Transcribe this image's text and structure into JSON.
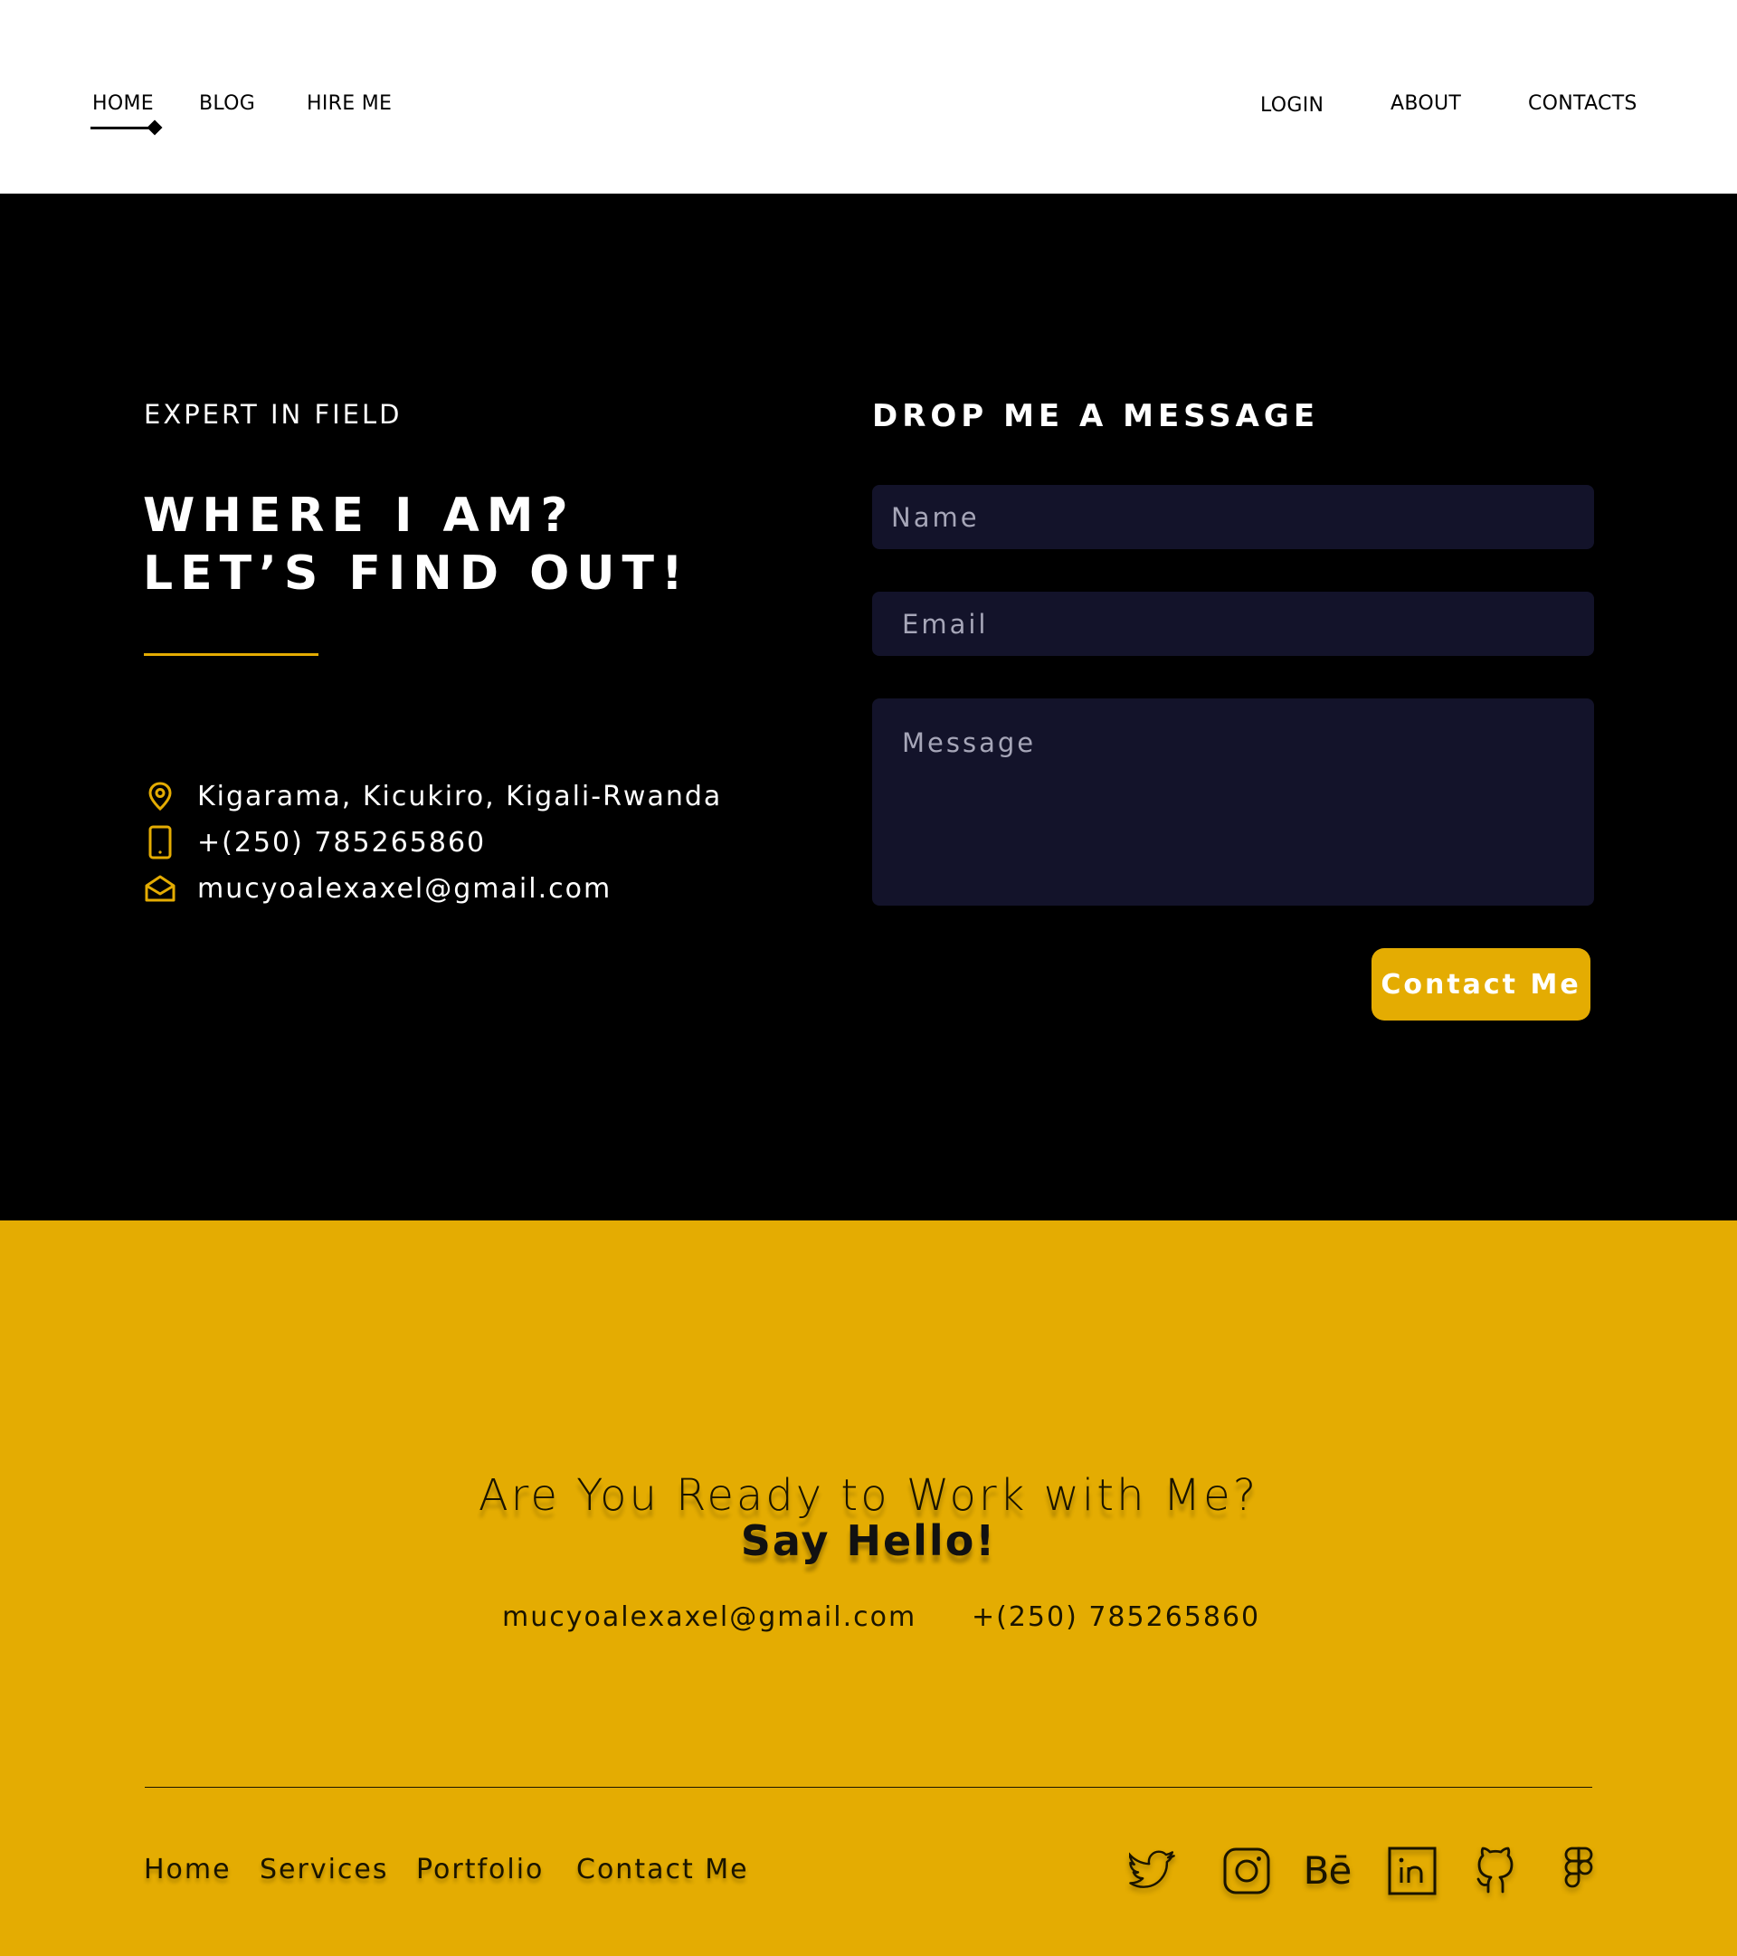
{
  "nav": {
    "left": [
      "HOME",
      "BLOG",
      "HIRE ME"
    ],
    "right": [
      "LOGIN",
      "ABOUT",
      "CONTACTS"
    ],
    "active": "HOME"
  },
  "contact": {
    "eyebrow": "EXPERT IN FIELD",
    "headline_line1": "WHERE I AM?",
    "headline_line2": "LET’S FIND OUT!",
    "address": "Kigarama, Kicukiro, Kigali-Rwanda",
    "phone": "+(250) 785265860",
    "email": "mucyoalexaxel@gmail.com",
    "form": {
      "title": "DROP ME A MESSAGE",
      "name_placeholder": "Name",
      "email_placeholder": "Email",
      "message_placeholder": "Message",
      "submit_label": "Contact Me"
    }
  },
  "footer": {
    "question": "Are You Ready to Work with Me?",
    "hello": "Say Hello!",
    "email": "mucyoalexaxel@gmail.com",
    "phone": "+(250) 785265860",
    "links": [
      "Home",
      "Services",
      "Portfolio",
      "Contact Me"
    ],
    "social_icons": [
      "twitter-icon",
      "instagram-icon",
      "behance-icon",
      "linkedin-icon",
      "github-icon",
      "figma-icon"
    ],
    "behance_glyph": "Bē"
  },
  "colors": {
    "accent": "#e4ac02",
    "dark": "#000000",
    "field_bg": "#13132a",
    "text_light": "#ffffff"
  }
}
